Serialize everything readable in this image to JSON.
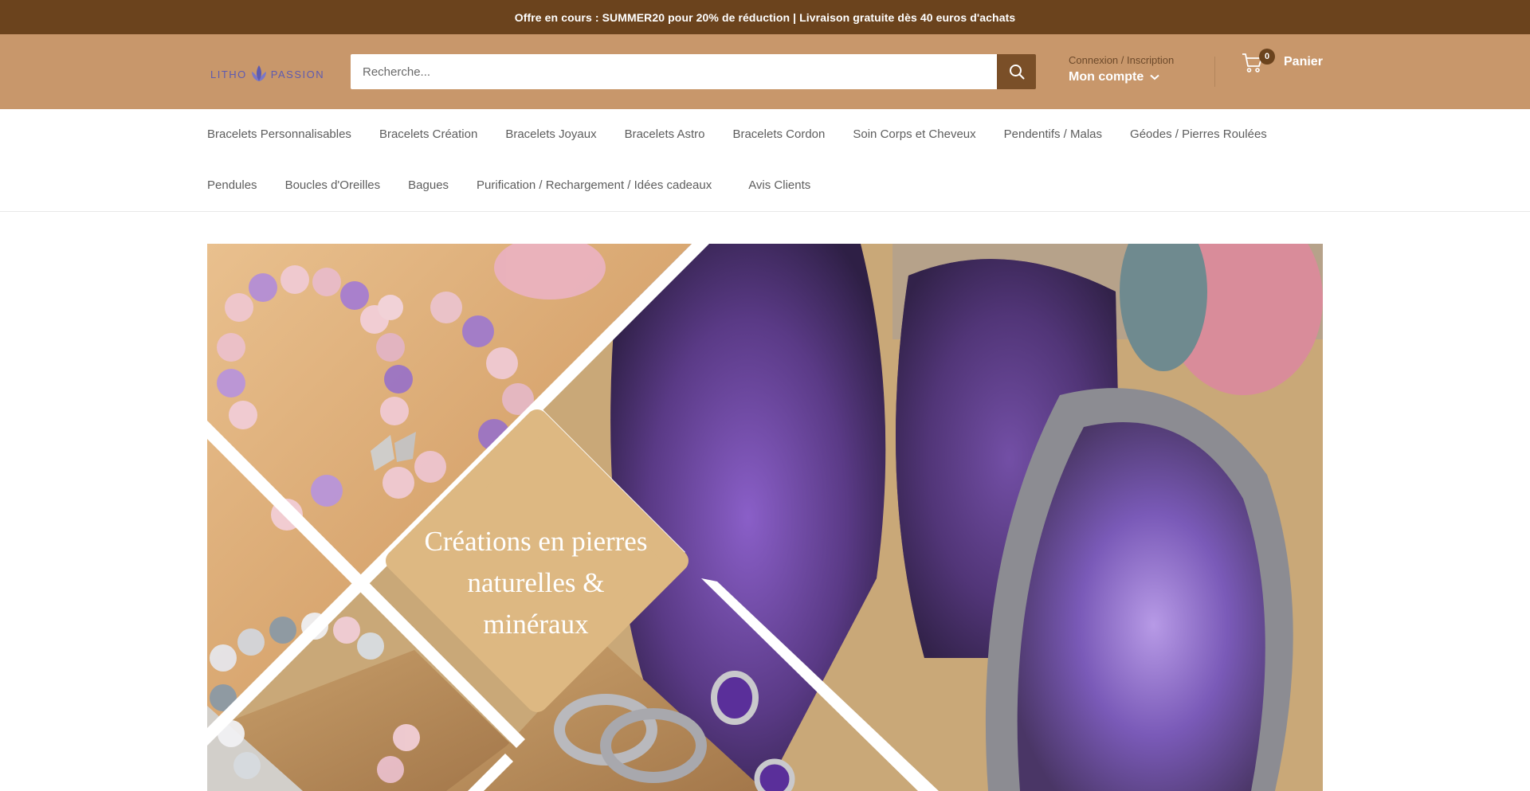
{
  "announcement": "Offre en cours : SUMMER20 pour 20% de réduction | Livraison gratuite dès 40 euros d'achats",
  "logo": {
    "text_left": "LITHO",
    "text_right": "PASSION"
  },
  "search": {
    "placeholder": "Recherche..."
  },
  "account": {
    "top_label": "Connexion / Inscription",
    "main_label": "Mon compte"
  },
  "cart": {
    "count": "0",
    "label": "Panier"
  },
  "nav": {
    "row1": [
      "Bracelets Personnalisables",
      "Bracelets Création",
      "Bracelets Joyaux",
      "Bracelets Astro",
      "Bracelets Cordon",
      "Soin Corps et Cheveux",
      "Pendentifs / Malas",
      "Géodes / Pierres Roulées"
    ],
    "row2": [
      "Pendules",
      "Boucles d'Oreilles",
      "Bagues",
      "Purification / Rechargement / Idées cadeaux",
      "Avis Clients"
    ]
  },
  "hero": {
    "line1": "Créations en pierres",
    "line2": "naturelles &",
    "line3": "minéraux"
  },
  "colors": {
    "announcement_bg": "#6b431d",
    "header_bg": "#c8976b",
    "search_button": "#7a4f28",
    "hero_diamond": "#ddb882"
  }
}
